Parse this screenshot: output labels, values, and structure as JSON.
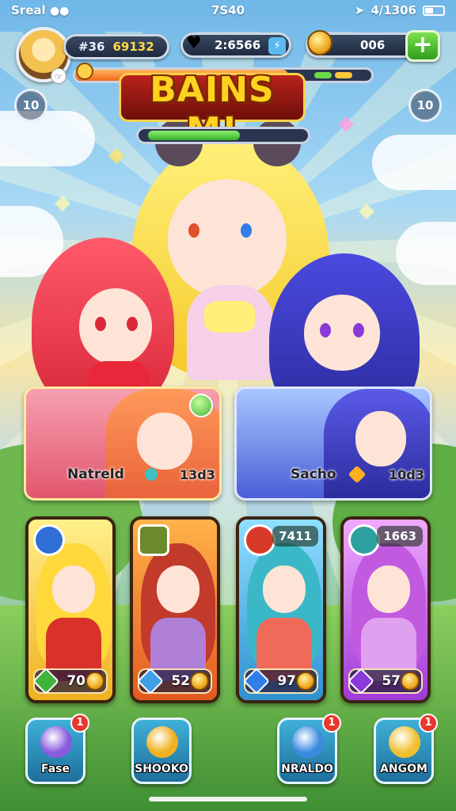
{
  "status_bar": {
    "carrier": "Sreal",
    "time": "7S40",
    "battery_text": "4/1306"
  },
  "hud": {
    "gems_label": "#36",
    "gems_value": "69132",
    "energy_value": "2:6566",
    "coins_value": "006",
    "left_round_label": "10",
    "right_round_label": "10"
  },
  "event": {
    "banner_title": "BAINS M!"
  },
  "progress": {
    "xp_fraction": 0.72,
    "hp_fraction": 0.6
  },
  "featured": [
    {
      "name": "Natreld",
      "value": "13d3"
    },
    {
      "name": "Sacho",
      "value": "10d3"
    }
  ],
  "heroes": [
    {
      "stat": "70",
      "tag": "",
      "badge_color": "#2f6fd6",
      "bg_top": "#fff08a",
      "bg_bottom": "#f0b020",
      "hair": "#ffd83a",
      "body": "#d8322a",
      "gem": "#3fb33a"
    },
    {
      "stat": "52",
      "tag": "",
      "badge_color": "#6b8a2a",
      "bg_top": "#ffb24a",
      "bg_bottom": "#e45a20",
      "hair": "#c23a2a",
      "body": "#b07fd8",
      "gem": "#3fa0e8"
    },
    {
      "stat": "97",
      "tag": "7411",
      "badge_color": "#d83a2a",
      "bg_top": "#8fe0ff",
      "bg_bottom": "#2f8fd0",
      "hair": "#3ab8c8",
      "body": "#f06a5a",
      "gem": "#2f7fe8"
    },
    {
      "stat": "57",
      "tag": "1663",
      "badge_color": "#2fa0a0",
      "bg_top": "#f0a8ff",
      "bg_bottom": "#a03ad8",
      "hair": "#c25ae0",
      "body": "#e0a0f0",
      "gem": "#8a3ad8"
    }
  ],
  "nav": [
    {
      "label": "Fase",
      "badge": "1",
      "icon_color": "#8a5ae0"
    },
    {
      "label": "SHOOKO",
      "badge": "",
      "icon_color": "#f0b020"
    },
    {
      "label": "NRALDO",
      "badge": "1",
      "icon_color": "#3a8ae0"
    },
    {
      "label": "ANGOM",
      "badge": "1",
      "icon_color": "#f0c030"
    }
  ]
}
